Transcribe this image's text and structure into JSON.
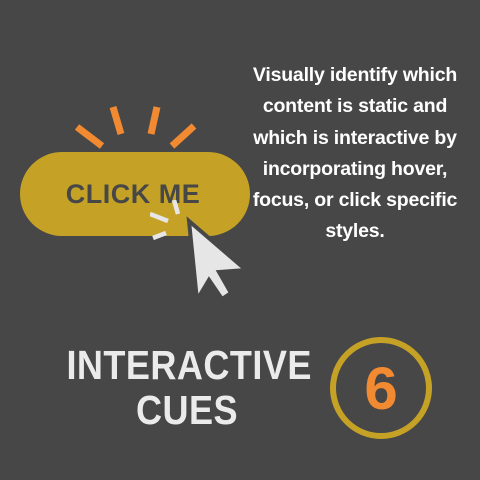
{
  "button": {
    "label": "CLICK ME"
  },
  "description": "Visually identify which content is static and which is interactive by incorporating hover, focus, or click specific styles.",
  "title": {
    "line1": "INTERACTIVE",
    "line2": "CUES"
  },
  "badge": {
    "number": "6"
  },
  "icons": {
    "burst": "click-burst-icon",
    "cursor": "mouse-cursor-icon",
    "sparkle": "click-sparkle-icon"
  },
  "colors": {
    "background": "#474747",
    "gold": "#c5a226",
    "orange": "#f28a32",
    "text": "#ffffff",
    "cursor": "#e6e6e6"
  }
}
